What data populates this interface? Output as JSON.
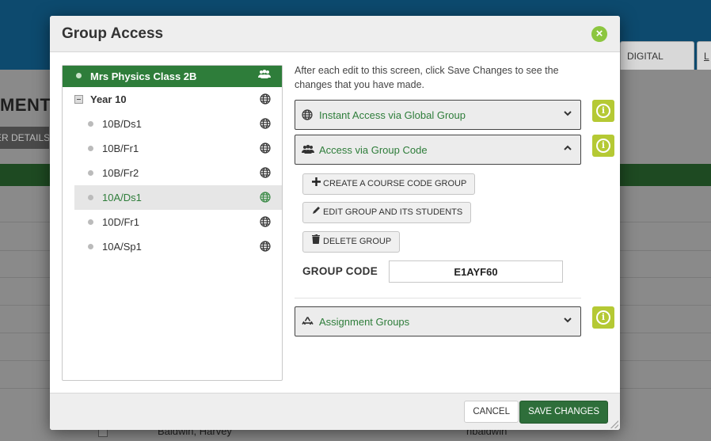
{
  "background": {
    "tabs": [
      "DIGITAL BOOK",
      "L"
    ],
    "page_title": "MENT",
    "strip_label": "ER DETAILS",
    "footer_row": {
      "name": "Baldwin, Harvey",
      "username": "hbaldwin"
    }
  },
  "modal": {
    "title": "Group Access",
    "close_icon": "close-circle-icon",
    "tree": {
      "root": {
        "label": "Mrs Physics Class 2B",
        "icon": "group-icon"
      },
      "year": {
        "label": "Year 10",
        "icon": "globe-icon"
      },
      "items": [
        {
          "label": "10B/Ds1",
          "selected": false
        },
        {
          "label": "10B/Fr1",
          "selected": false
        },
        {
          "label": "10B/Fr2",
          "selected": false
        },
        {
          "label": "10A/Ds1",
          "selected": true
        },
        {
          "label": "10D/Fr1",
          "selected": false
        },
        {
          "label": "10A/Sp1",
          "selected": false
        }
      ]
    },
    "intro_text": "After each edit to this screen, click Save Changes to see the changes that you have made.",
    "sections": {
      "instant_access": {
        "label": "Instant Access via Global Group",
        "icon": "globe-icon",
        "expanded": false
      },
      "group_code_access": {
        "label": "Access via Group Code",
        "icon": "group-icon",
        "expanded": true
      },
      "assignment_groups": {
        "label": "Assignment Groups",
        "icon": "recycle-icon",
        "expanded": false
      }
    },
    "group_code_buttons": {
      "create": "CREATE A COURSE CODE GROUP",
      "edit": "EDIT GROUP AND ITS STUDENTS",
      "delete": "DELETE GROUP"
    },
    "group_code": {
      "label": "GROUP CODE",
      "value": "E1AYF60"
    },
    "footer": {
      "cancel": "CANCEL",
      "save": "SAVE CHANGES"
    },
    "colors": {
      "accent_green": "#2e7d3a",
      "info_lime": "#b5c934",
      "close_green": "#8cc63f"
    }
  }
}
